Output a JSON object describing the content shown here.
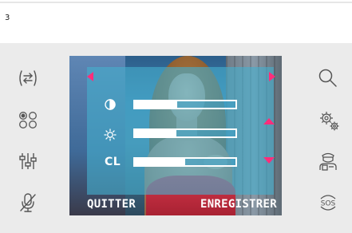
{
  "page": {
    "number": "3"
  },
  "left_icons": [
    {
      "name": "door-release-icon"
    },
    {
      "name": "camera-switch-icon"
    },
    {
      "name": "settings-sliders-icon"
    },
    {
      "name": "microphone-mute-icon"
    }
  ],
  "right_icons": [
    {
      "name": "magnifier-icon"
    },
    {
      "name": "gears-icon"
    },
    {
      "name": "concierge-icon"
    },
    {
      "name": "sos-icon",
      "text": "SOS"
    }
  ],
  "screen": {
    "settings": [
      {
        "id": "contrast",
        "icon": "contrast-icon",
        "level": 0.42
      },
      {
        "id": "brightness",
        "icon": "brightness-icon",
        "level": 0.41
      },
      {
        "id": "color",
        "label": "CL",
        "level": 0.5
      }
    ],
    "arrows": [
      "arrow-left",
      "arrow-right",
      "arrow-up",
      "arrow-down"
    ],
    "softkeys": {
      "left": "QUITTER",
      "right": "ENREGISTRER"
    },
    "colors": {
      "accent": "#ff2d7a",
      "overlay": "#46afcd",
      "device": "#ebebeb"
    }
  }
}
